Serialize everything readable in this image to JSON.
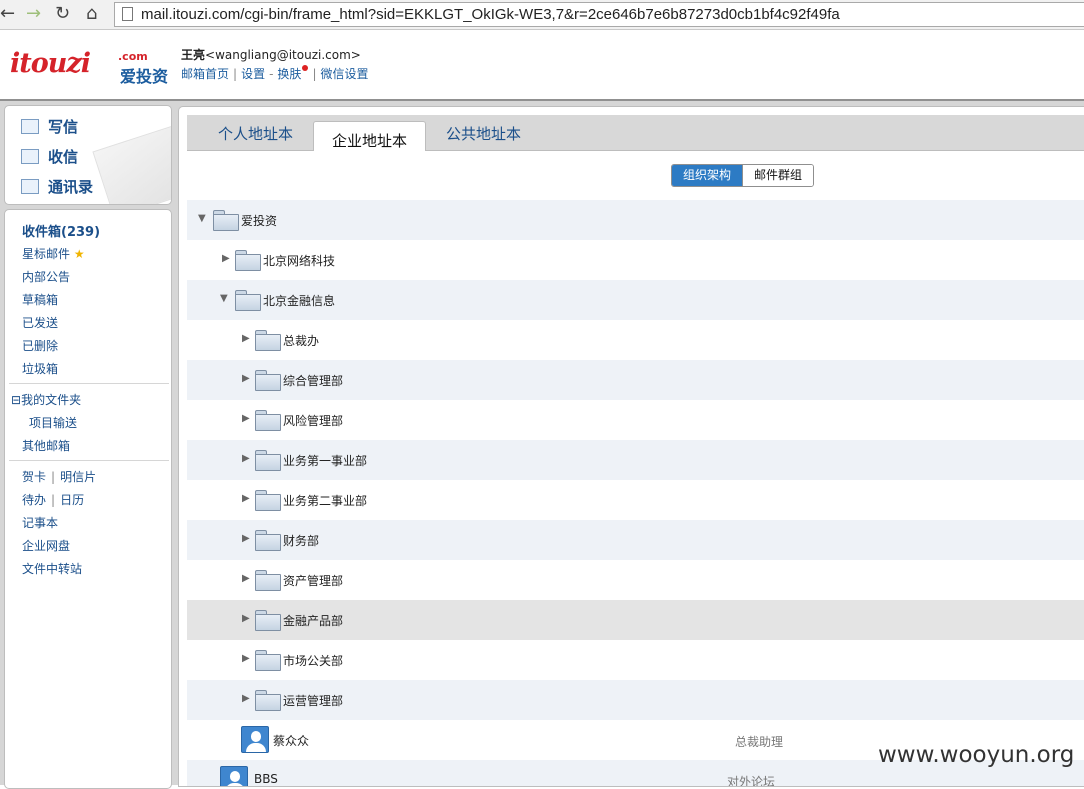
{
  "browser": {
    "url": "mail.itouzi.com/cgi-bin/frame_html?sid=EKKLGT_OkIGk-WE3,7&r=2ce646b7e6b87273d0cb1bf4c92f49fa",
    "back": "←",
    "forward": "→",
    "reload": "↻",
    "home": "⌂"
  },
  "header": {
    "logo_text": "itouzi",
    "logo_com": ".com",
    "logo_cn": "爱投资",
    "user_name": "王亮",
    "user_email": "<wangliang@itouzi.com>",
    "links": [
      "邮箱首页",
      "设置",
      "换肤",
      "微信设置"
    ],
    "separator_bar": "|",
    "separator_dash": "-"
  },
  "compose": {
    "write": "写信",
    "receive": "收信",
    "contacts": "通讯录"
  },
  "folders": {
    "inbox": "收件箱(239)",
    "starred": "星标邮件",
    "star_glyph": "★",
    "announce": "内部公告",
    "drafts": "草稿箱",
    "sent": "已发送",
    "deleted": "已删除",
    "spam": "垃圾箱",
    "my_folders_toggle": "⊟",
    "my_folders": "我的文件夹",
    "project": "项目输送",
    "other_mailbox": "其他邮箱",
    "greeting_card": "贺卡",
    "postcard": "明信片",
    "todo": "待办",
    "calendar": "日历",
    "notebook": "记事本",
    "netdisk": "企业网盘",
    "transfer": "文件中转站",
    "sep": "|"
  },
  "tabs": [
    "个人地址本",
    "企业地址本",
    "公共地址本"
  ],
  "view_toggle": {
    "org": "组织架构",
    "groups": "邮件群组"
  },
  "tree": [
    {
      "label": "爱投资",
      "arrow": "▼"
    },
    {
      "label": "北京网络科技",
      "arrow": "▶"
    },
    {
      "label": "北京金融信息",
      "arrow": "▼"
    },
    {
      "label": "总裁办",
      "arrow": "▶"
    },
    {
      "label": "综合管理部",
      "arrow": "▶"
    },
    {
      "label": "风险管理部",
      "arrow": "▶"
    },
    {
      "label": "业务第一事业部",
      "arrow": "▶"
    },
    {
      "label": "业务第二事业部",
      "arrow": "▶"
    },
    {
      "label": "财务部",
      "arrow": "▶"
    },
    {
      "label": "资产管理部",
      "arrow": "▶"
    },
    {
      "label": "金融产品部",
      "arrow": "▶"
    },
    {
      "label": "市场公关部",
      "arrow": "▶"
    },
    {
      "label": "运营管理部",
      "arrow": "▶"
    }
  ],
  "contacts": [
    {
      "name": "蔡众众",
      "role": "总裁助理"
    },
    {
      "name": "BBS",
      "role": "对外论坛"
    }
  ],
  "watermark": "www.wooyun.org"
}
